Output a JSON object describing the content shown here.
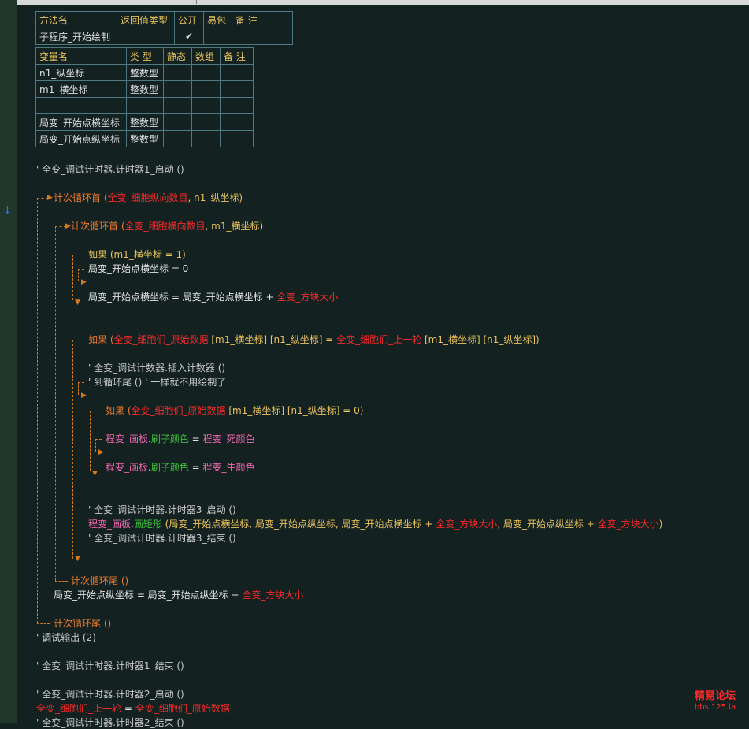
{
  "method_table": {
    "headers": [
      "方法名",
      "返回值类型",
      "公开",
      "易包",
      "备 注"
    ],
    "row": {
      "name": "子程序_开始绘制",
      "return_type": "",
      "public_check": "✔",
      "easy_pkg": "",
      "note": ""
    }
  },
  "var_table": {
    "headers": [
      "变量名",
      "类 型",
      "静态",
      "数组",
      "备 注"
    ],
    "rows": [
      {
        "name": "n1_纵坐标",
        "type": "整数型"
      },
      {
        "name": "m1_横坐标",
        "type": "整数型"
      },
      {
        "name": "",
        "type": ""
      },
      {
        "name": "局变_开始点横坐标",
        "type": "整数型"
      },
      {
        "name": "局变_开始点纵坐标",
        "type": "整数型"
      }
    ]
  },
  "code": {
    "l1": {
      "a": "' 全变_调试计时器.计时器1_启动 ()"
    },
    "l2": {
      "a": "计次循环首 (",
      "b": "全变_细胞纵向数目",
      "c": ", n1_纵坐标)"
    },
    "l3": {
      "a": "计次循环首 (",
      "b": "全变_细胞横向数目",
      "c": ", m1_横坐标)"
    },
    "l4": {
      "a": "如果 (m1_横坐标 = 1)"
    },
    "l5": {
      "a": "局变_开始点横坐标 = 0"
    },
    "l6": {
      "a": "局变_开始点横坐标 = 局变_开始点横坐标 + ",
      "b": "全变_方块大小"
    },
    "l7": {
      "a": "如果 (",
      "b": "全变_细胞们_原始数据",
      "c": " [m1_横坐标] [n1_纵坐标] = ",
      "d": "全变_细胞们_上一轮",
      "e": " [m1_横坐标] [n1_纵坐标])"
    },
    "l8": {
      "a": "' 全变_调试计数器.插入计数器 ()"
    },
    "l9": {
      "a": "' 到循环尾 () ' 一样就不用绘制了"
    },
    "l10": {
      "a": "如果 (",
      "b": "全变_细胞们_原始数据",
      "c": " [m1_横坐标] [n1_纵坐标] = 0)"
    },
    "l11": {
      "a": "程变_画板",
      "b": ".",
      "c": "刷子颜色",
      "d": " = ",
      "e": "程变_死颜色"
    },
    "l12": {
      "a": "程变_画板",
      "b": ".",
      "c": "刷子颜色",
      "d": " = ",
      "e": "程变_生颜色"
    },
    "l13": {
      "a": "' 全变_调试计时器.计时器3_启动 ()"
    },
    "l14": {
      "a": "程变_画板",
      "b": ".",
      "c": "画矩形",
      "d": " (局变_开始点横坐标, 局变_开始点纵坐标, 局变_开始点横坐标 + ",
      "e": "全变_方块大小",
      "f": ", 局变_开始点纵坐标 + ",
      "g": "全变_方块大小",
      "h": ")"
    },
    "l15": {
      "a": "' 全变_调试计时器.计时器3_结束 ()"
    },
    "l16": {
      "a": "计次循环尾 ()"
    },
    "l17": {
      "a": "局变_开始点纵坐标 = 局变_开始点纵坐标 + ",
      "b": "全变_方块大小"
    },
    "l18": {
      "a": "计次循环尾 ()"
    },
    "l19": {
      "a": "' 调试输出 (2)"
    },
    "l20": {
      "a": "' 全变_调试计时器.计时器1_结束 ()"
    },
    "l21": {
      "a": "' 全变_调试计时器.计时器2_启动 ()"
    },
    "l22": {
      "a": "全变_细胞们_上一轮",
      "b": " = ",
      "c": "全变_细胞们_原始数据"
    },
    "l23": {
      "a": "' 全变_调试计时器.计时器2_结束 ()"
    }
  },
  "watermark": {
    "line1": "精易论坛",
    "line2": "bbs.125.la"
  },
  "colors": {
    "background": "#142121",
    "keyword": "#e87b2c",
    "global_var": "#f52a2a",
    "program_var": "#f068b0",
    "method": "#3cc03c",
    "comment": "#c9c9c9",
    "header": "#e8c35a"
  }
}
